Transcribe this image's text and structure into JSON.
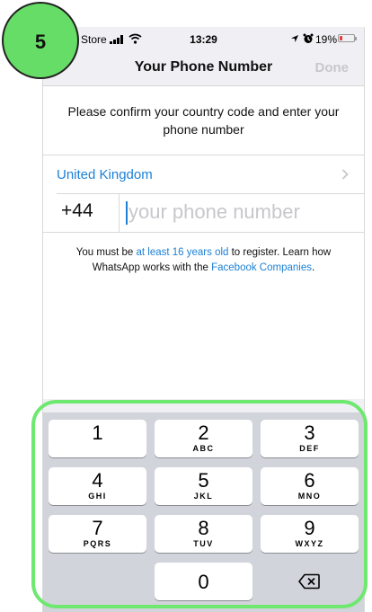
{
  "step_badge": "5",
  "status_bar": {
    "carrier": "Store",
    "time": "13:29",
    "battery_percent": "19%",
    "battery_level": 0.19,
    "battery_color": "#e53935"
  },
  "nav": {
    "title": "Your Phone Number",
    "done_label": "Done"
  },
  "instructions": "Please confirm your country code and enter your phone number",
  "country": {
    "name": "United Kingdom",
    "code": "+44"
  },
  "phone_input": {
    "value": "",
    "placeholder": "your phone number"
  },
  "age_note": {
    "part1": "You must be ",
    "link1": "at least 16 years old",
    "part2": " to register. Learn how WhatsApp works with the ",
    "link2": "Facebook Companies",
    "part3": "."
  },
  "keypad": [
    {
      "num": "1",
      "letters": ""
    },
    {
      "num": "2",
      "letters": "ABC"
    },
    {
      "num": "3",
      "letters": "DEF"
    },
    {
      "num": "4",
      "letters": "GHI"
    },
    {
      "num": "5",
      "letters": "JKL"
    },
    {
      "num": "6",
      "letters": "MNO"
    },
    {
      "num": "7",
      "letters": "PQRS"
    },
    {
      "num": "8",
      "letters": "TUV"
    },
    {
      "num": "9",
      "letters": "WXYZ"
    },
    {
      "num": "0",
      "letters": ""
    }
  ],
  "colors": {
    "link": "#1c80d6",
    "highlight": "#6ee86e",
    "badge": "#66dd66"
  }
}
